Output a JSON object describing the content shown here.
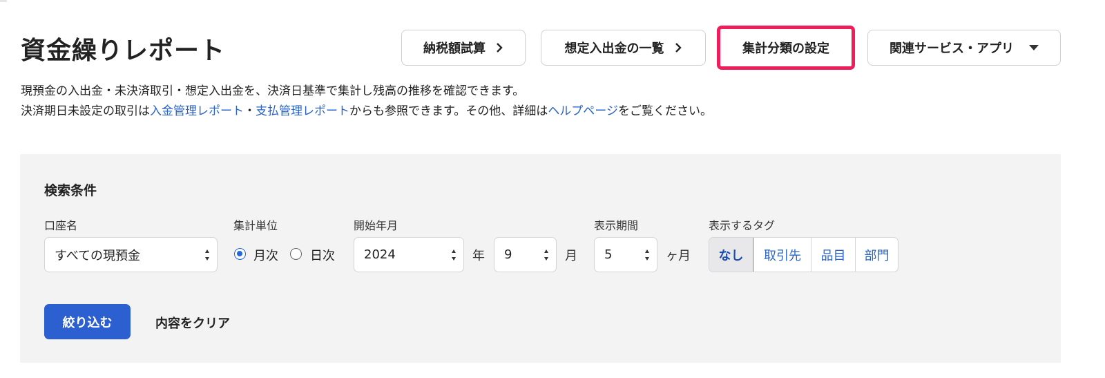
{
  "header": {
    "title": "資金繰りレポート",
    "buttons": [
      {
        "label": "納税額試算",
        "icon": "chevron-right-icon"
      },
      {
        "label": "想定入出金の一覧",
        "icon": "chevron-right-icon"
      },
      {
        "label": "集計分類の設定",
        "highlight_color": "#ef1e5a"
      },
      {
        "label": "関連サービス・アプリ",
        "icon": "caret-down-icon"
      }
    ]
  },
  "description": {
    "line1": "現預金の入出金・未決済取引・想定入出金を、決済日基準で集計し残高の推移を確認できます。",
    "line2_part1": "決済期日未設定の取引は",
    "link_income": "入金管理レポート",
    "separator": "・",
    "link_payment": "支払管理レポート",
    "line2_part2": "からも参照できます。その他、詳細は",
    "link_help": "ヘルプページ",
    "line2_part3": "をご覧ください。"
  },
  "search": {
    "title": "検索条件",
    "account": {
      "label": "口座名",
      "value": "すべての現預金"
    },
    "unit": {
      "label": "集計単位",
      "options": [
        "月次",
        "日次"
      ],
      "selected": "月次"
    },
    "start": {
      "label": "開始年月",
      "year": "2024",
      "year_unit": "年",
      "month": "9",
      "month_unit": "月"
    },
    "period": {
      "label": "表示期間",
      "value": "5",
      "unit": "ヶ月"
    },
    "tags": {
      "label": "表示するタグ",
      "options": [
        "なし",
        "取引先",
        "品目",
        "部門"
      ],
      "selected": "なし"
    },
    "submit_label": "絞り込む",
    "clear_label": "内容をクリア"
  },
  "colors": {
    "accent": "#2c5fcf",
    "link": "#2a64c8",
    "highlight": "#ef1e5a",
    "panel_bg": "#f4f3f3"
  }
}
